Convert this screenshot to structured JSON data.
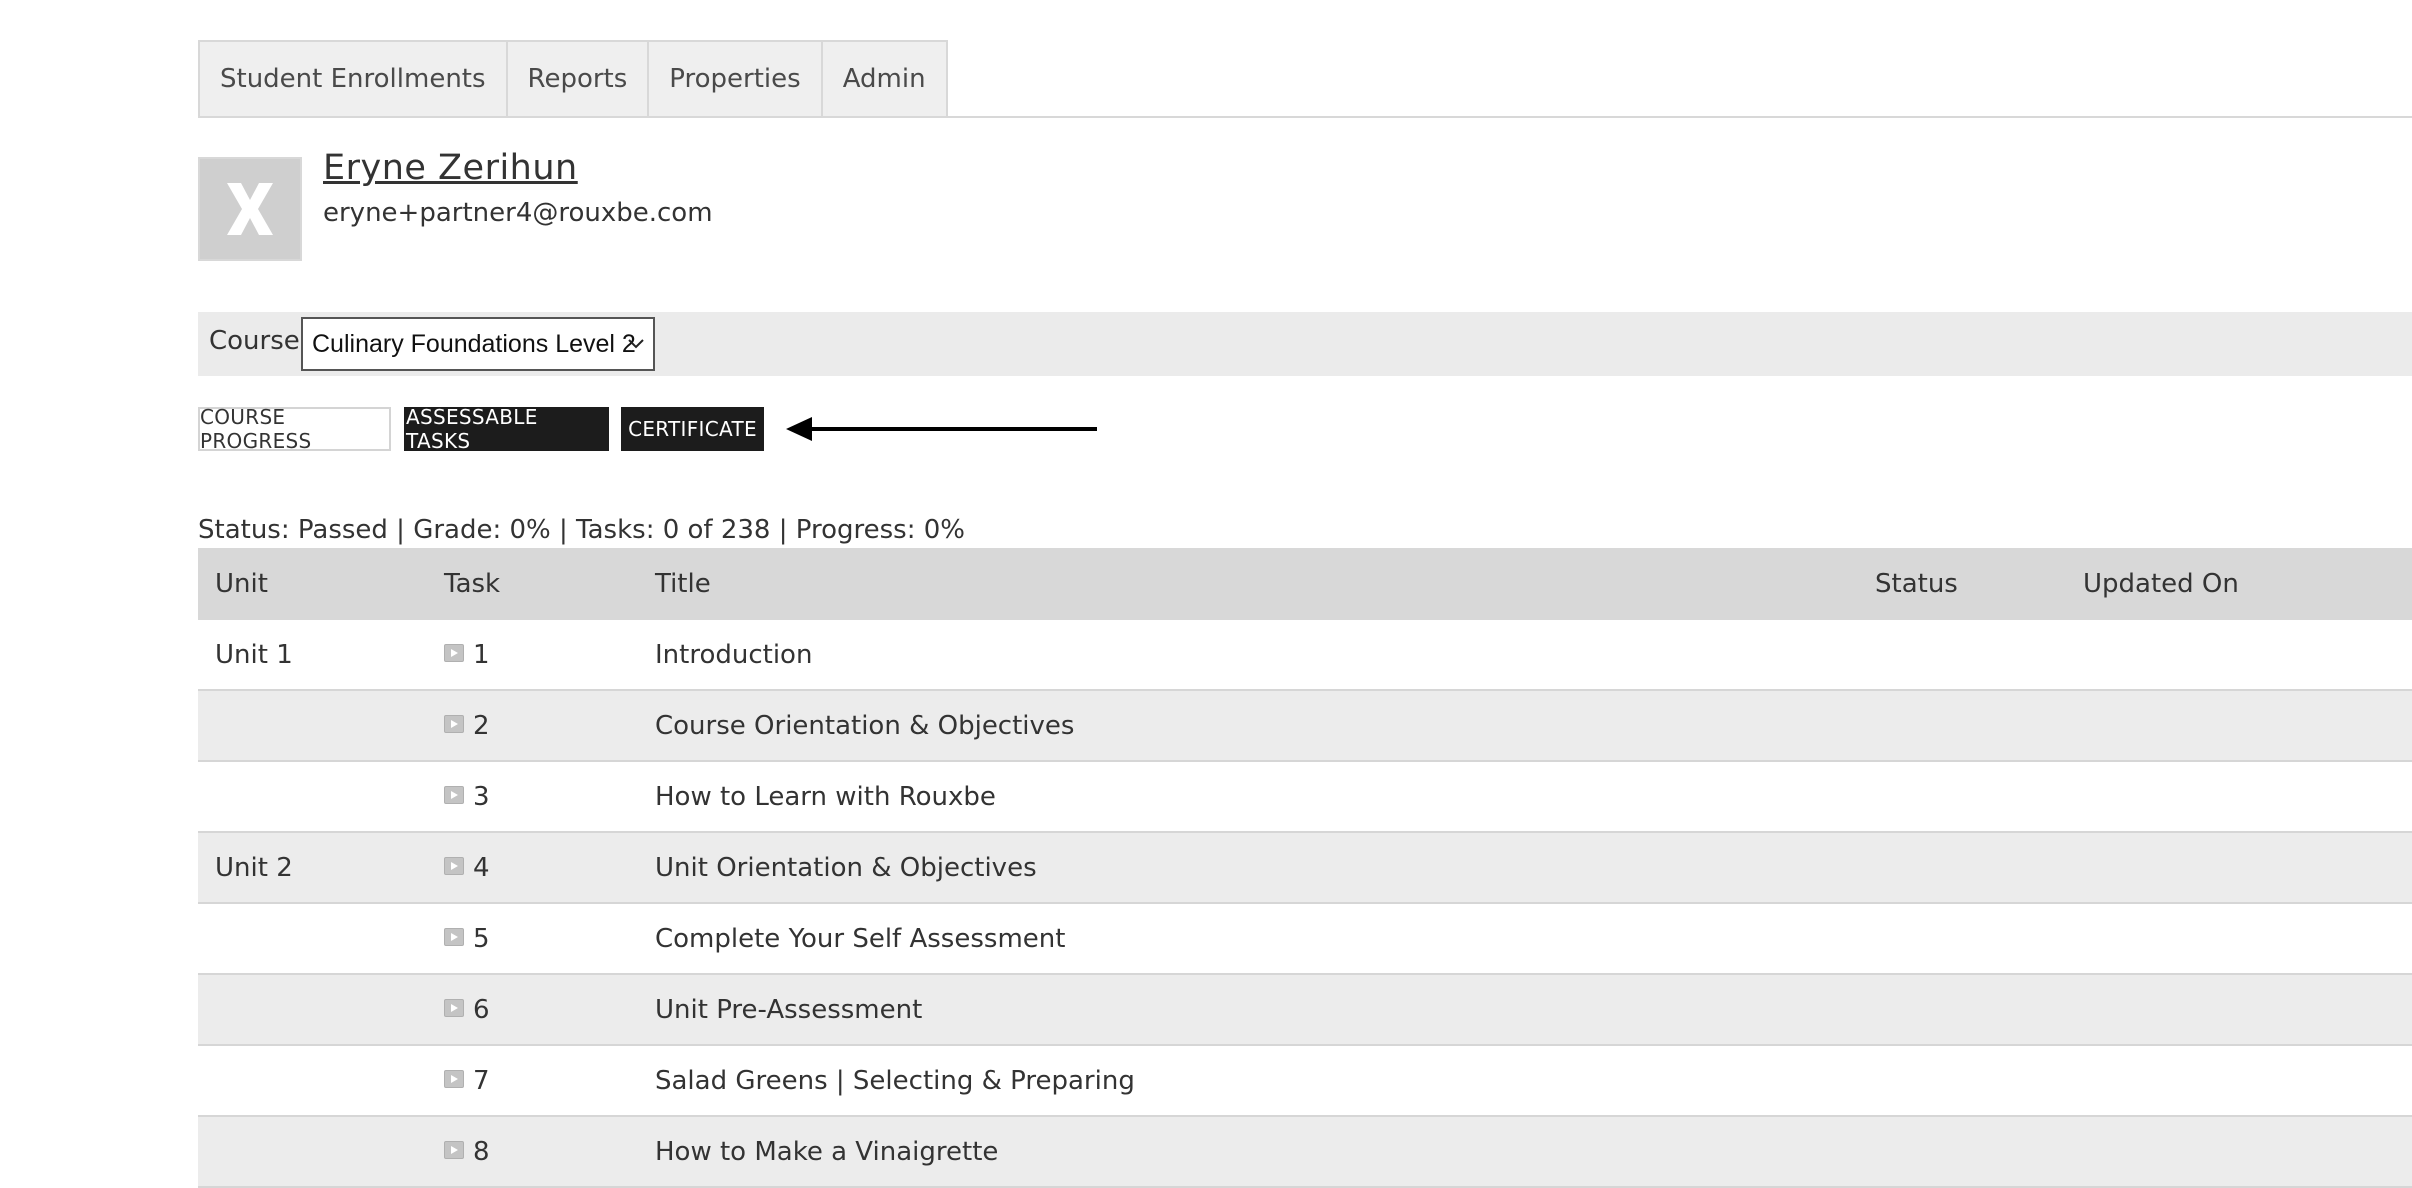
{
  "tabs": [
    "Student Enrollments",
    "Reports",
    "Properties",
    "Admin"
  ],
  "profile": {
    "name": "Eryne Zerihun",
    "email": "eryne+partner4@rouxbe.com",
    "avatar_icon": "x-logo-icon"
  },
  "course": {
    "label": "Course:",
    "selected": "Culinary Foundations Level 2"
  },
  "buttons": {
    "course_progress": "COURSE PROGRESS",
    "assessable_tasks": "ASSESSABLE TASKS",
    "certificate": "CERTIFICATE"
  },
  "summary": "Status: Passed | Grade: 0% | Tasks: 0 of 238 | Progress: 0%",
  "table": {
    "headers": {
      "unit": "Unit",
      "task": "Task",
      "title": "Title",
      "status": "Status",
      "updated": "Updated On"
    },
    "rows": [
      {
        "unit": "Unit 1",
        "task": "1",
        "title": "Introduction",
        "status": "",
        "updated": ""
      },
      {
        "unit": "",
        "task": "2",
        "title": "Course Orientation & Objectives",
        "status": "",
        "updated": ""
      },
      {
        "unit": "",
        "task": "3",
        "title": "How to Learn with Rouxbe",
        "status": "",
        "updated": ""
      },
      {
        "unit": "Unit 2",
        "task": "4",
        "title": "Unit Orientation & Objectives",
        "status": "",
        "updated": ""
      },
      {
        "unit": "",
        "task": "5",
        "title": "Complete Your Self Assessment",
        "status": "",
        "updated": ""
      },
      {
        "unit": "",
        "task": "6",
        "title": "Unit Pre-Assessment",
        "status": "",
        "updated": ""
      },
      {
        "unit": "",
        "task": "7",
        "title": "Salad Greens | Selecting & Preparing",
        "status": "",
        "updated": ""
      },
      {
        "unit": "",
        "task": "8",
        "title": "How to Make a Vinaigrette",
        "status": "",
        "updated": ""
      }
    ]
  },
  "colors": {
    "header_bg": "#d8d8d8",
    "alt_row_bg": "#ececec",
    "dark_button_bg": "#1c1c1c"
  }
}
